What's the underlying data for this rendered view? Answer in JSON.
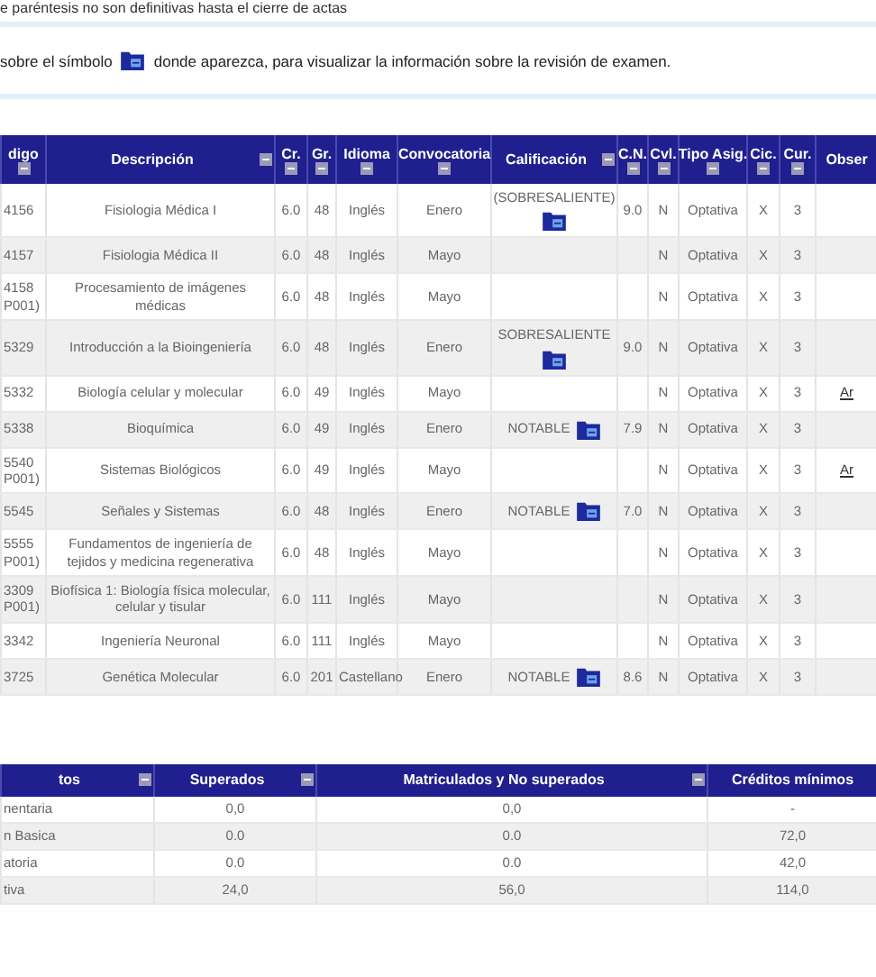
{
  "note_top": "e paréntesis no son definitivas hasta el cierre de actas",
  "info": {
    "before": "sobre el símbolo",
    "after": "donde aparezca, para visualizar la información sobre la revisión de examen."
  },
  "grades": {
    "columns": [
      {
        "label": "digo",
        "sortable": true
      },
      {
        "label": "Descripción",
        "sortable": true
      },
      {
        "label": "Cr.",
        "sortable": true
      },
      {
        "label": "Gr.",
        "sortable": true
      },
      {
        "label": "Idioma",
        "sortable": true
      },
      {
        "label": "Convocatoria",
        "sortable": true
      },
      {
        "label": "Calificación",
        "sortable": true
      },
      {
        "label": "C.N.",
        "sortable": true
      },
      {
        "label": "Cvl.",
        "sortable": true
      },
      {
        "label": "Tipo Asig.",
        "sortable": true
      },
      {
        "label": "Cic.",
        "sortable": true
      },
      {
        "label": "Cur.",
        "sortable": true
      },
      {
        "label": "Obser",
        "sortable": false
      }
    ],
    "rows": [
      {
        "code": "4156",
        "desc": "Fisiologia Médica I",
        "cr": "6.0",
        "gr": "48",
        "idioma": "Inglés",
        "conv": "Enero",
        "calif": "(SOBRESALIENTE)",
        "review": true,
        "cn": "9.0",
        "cvl": "N",
        "tipo": "Optativa",
        "cic": "X",
        "cur": "3"
      },
      {
        "code": "4157",
        "desc": "Fisiologia Médica II",
        "cr": "6.0",
        "gr": "48",
        "idioma": "Inglés",
        "conv": "Mayo",
        "review": false,
        "cvl": "N",
        "tipo": "Optativa",
        "cic": "X",
        "cur": "3"
      },
      {
        "code": "4158 P001)",
        "desc": "Procesamiento de imágenes médicas",
        "cr": "6.0",
        "gr": "48",
        "idioma": "Inglés",
        "conv": "Mayo",
        "review": false,
        "cvl": "N",
        "tipo": "Optativa",
        "cic": "X",
        "cur": "3"
      },
      {
        "code": "5329",
        "desc": "Introducción a la Bioingeniería",
        "cr": "6.0",
        "gr": "48",
        "idioma": "Inglés",
        "conv": "Enero",
        "calif": "SOBRESALIENTE",
        "review": true,
        "cn": "9.0",
        "cvl": "N",
        "tipo": "Optativa",
        "cic": "X",
        "cur": "3"
      },
      {
        "code": "5332",
        "desc": "Biología celular y molecular",
        "cr": "6.0",
        "gr": "49",
        "idioma": "Inglés",
        "conv": "Mayo",
        "review": false,
        "cvl": "N",
        "tipo": "Optativa",
        "cic": "X",
        "cur": "3",
        "obs": "Ar"
      },
      {
        "code": "5338",
        "desc": "Bioquímica",
        "cr": "6.0",
        "gr": "49",
        "idioma": "Inglés",
        "conv": "Enero",
        "calif": "NOTABLE",
        "review": true,
        "cn": "7.9",
        "cvl": "N",
        "tipo": "Optativa",
        "cic": "X",
        "cur": "3"
      },
      {
        "code": "5540 P001)",
        "desc": "Sistemas Biológicos",
        "cr": "6.0",
        "gr": "49",
        "idioma": "Inglés",
        "conv": "Mayo",
        "review": false,
        "cvl": "N",
        "tipo": "Optativa",
        "cic": "X",
        "cur": "3",
        "obs": "Ar"
      },
      {
        "code": "5545",
        "desc": "Señales y Sistemas",
        "cr": "6.0",
        "gr": "48",
        "idioma": "Inglés",
        "conv": "Enero",
        "calif": "NOTABLE",
        "review": true,
        "cn": "7.0",
        "cvl": "N",
        "tipo": "Optativa",
        "cic": "X",
        "cur": "3"
      },
      {
        "code": "5555 P001)",
        "desc": "Fundamentos de ingeniería de tejidos y medicina regenerativa",
        "cr": "6.0",
        "gr": "48",
        "idioma": "Inglés",
        "conv": "Mayo",
        "review": false,
        "cvl": "N",
        "tipo": "Optativa",
        "cic": "X",
        "cur": "3"
      },
      {
        "code": "3309 P001)",
        "desc": "Biofísica 1: Biología física molecular, celular y tisular",
        "cr": "6.0",
        "gr": "111",
        "idioma": "Inglés",
        "conv": "Mayo",
        "review": false,
        "cvl": "N",
        "tipo": "Optativa",
        "cic": "X",
        "cur": "3"
      },
      {
        "code": "3342",
        "desc": "Ingeniería Neuronal",
        "cr": "6.0",
        "gr": "111",
        "idioma": "Inglés",
        "conv": "Mayo",
        "review": false,
        "cvl": "N",
        "tipo": "Optativa",
        "cic": "X",
        "cur": "3"
      },
      {
        "code": "3725",
        "desc": "Genética Molecular",
        "cr": "6.0",
        "gr": "201",
        "idioma": "Castellano",
        "conv": "Enero",
        "calif": "NOTABLE",
        "review": true,
        "cn": "8.6",
        "cvl": "N",
        "tipo": "Optativa",
        "cic": "X",
        "cur": "3"
      }
    ]
  },
  "credits": {
    "columns": [
      {
        "label": "tos",
        "sortable": true
      },
      {
        "label": "Superados",
        "sortable": true
      },
      {
        "label": "Matriculados y No superados",
        "sortable": true
      },
      {
        "label": "Créditos mínimos",
        "sortable": false
      }
    ],
    "rows": [
      [
        "nentaria",
        "0,0",
        "0,0",
        "-"
      ],
      [
        "n Basica",
        "0.0",
        "0.0",
        "72,0"
      ],
      [
        "atoria",
        "0.0",
        "0.0",
        "42,0"
      ],
      [
        "tiva",
        "24,0",
        "56,0",
        "114,0"
      ]
    ]
  }
}
